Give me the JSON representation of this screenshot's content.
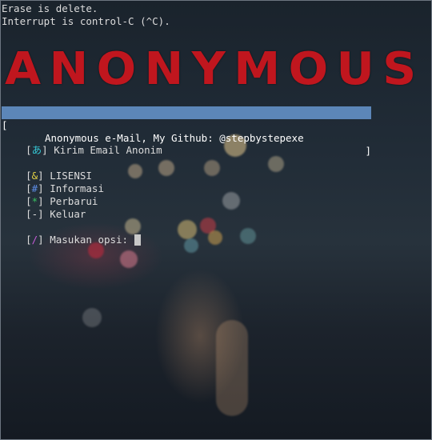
{
  "terminal": {
    "info_lines": [
      "Erase is delete.",
      "Interrupt is control-C (^C)."
    ],
    "banner": "ANONYMOUS",
    "title_bar": {
      "left_bracket": "[",
      "text": "Anonymous e-Mail, My Github: @stepbystepexe",
      "right_bracket": "]"
    },
    "menu": [
      {
        "key": "あ",
        "label": "Kirim Email Anonim"
      },
      {
        "key": "&",
        "label": "LISENSI"
      },
      {
        "key": "#",
        "label": "Informasi"
      },
      {
        "key": "*",
        "label": "Perbarui"
      },
      {
        "key": "-",
        "label": "Keluar"
      }
    ],
    "prompt": {
      "key": "/",
      "label": "Masukan opsi:",
      "value": ""
    }
  },
  "colors": {
    "banner": "#c0161e",
    "title_bar_bg": "#5c86b8",
    "key_main": "#36c8d6",
    "key_license": "#e0d045",
    "key_info": "#5d8ee8",
    "key_update": "#38c060",
    "key_exit": "#dcdcdc",
    "key_prompt": "#c65bd8"
  }
}
